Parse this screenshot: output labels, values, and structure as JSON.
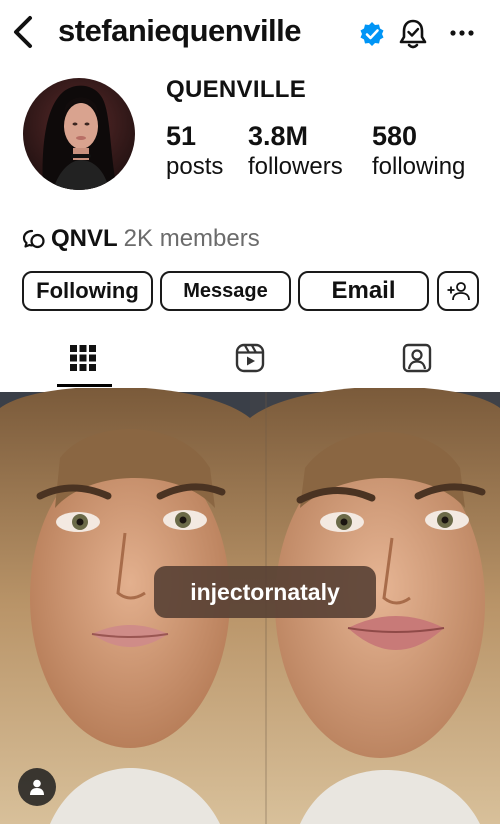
{
  "header": {
    "username": "stefaniequenville",
    "icons": [
      "back-arrow-icon",
      "verified-badge-icon",
      "notification-bell-icon",
      "more-options-icon"
    ]
  },
  "profile": {
    "display_name": "QUENVILLE",
    "stats": [
      {
        "value": "51",
        "label": "posts"
      },
      {
        "value": "3.8M",
        "label": "followers"
      },
      {
        "value": "580",
        "label": "following"
      }
    ],
    "channel": {
      "name": "QNVL",
      "members": "2K members",
      "icon": "broadcast-channel-icon"
    }
  },
  "actions": {
    "following": "Following",
    "message": "Message",
    "email": "Email",
    "add_user_icon": "add-person-icon"
  },
  "tabs": [
    {
      "icon": "grid-icon",
      "active": true
    },
    {
      "icon": "reels-icon",
      "active": false
    },
    {
      "icon": "tagged-person-icon",
      "active": false
    }
  ],
  "post": {
    "tag_label": "injectornataly",
    "tagged_icon": "person-icon"
  },
  "colors": {
    "verified_blue": "#0095f6",
    "tag_pill_bg": "#584034",
    "text_primary": "#111111",
    "text_secondary": "#6b6b6b"
  }
}
